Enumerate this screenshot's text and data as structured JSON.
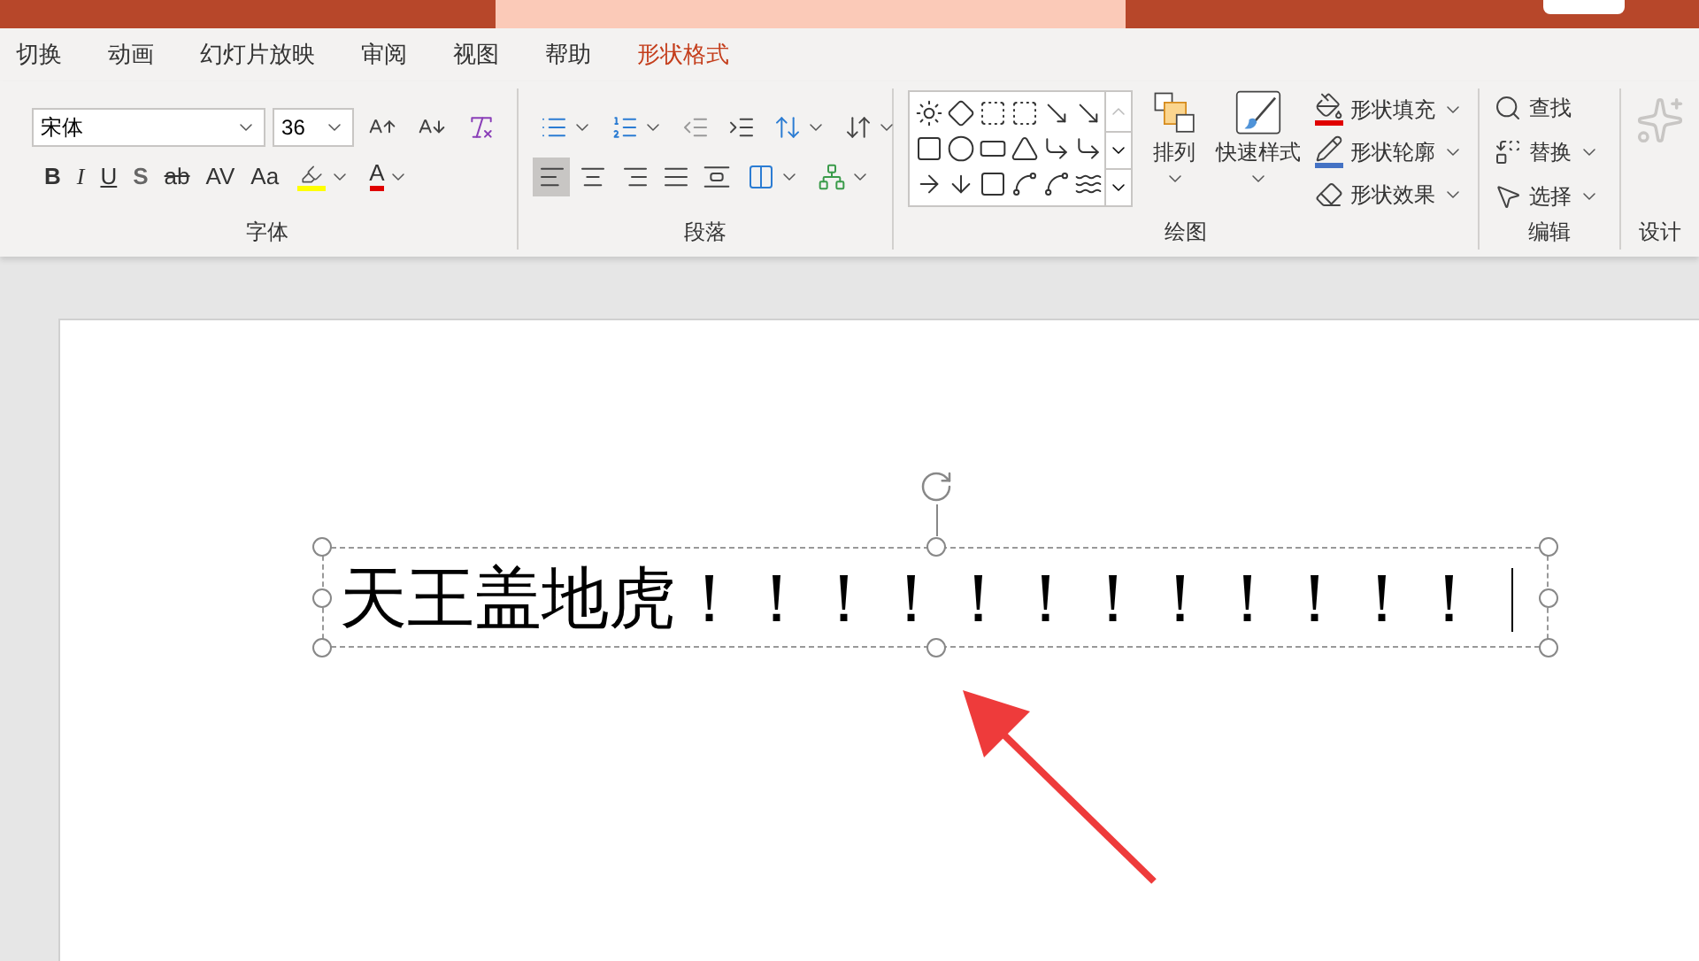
{
  "tabs": [
    {
      "label": "切换",
      "selected": false
    },
    {
      "label": "动画",
      "selected": false
    },
    {
      "label": "幻灯片放映",
      "selected": false
    },
    {
      "label": "审阅",
      "selected": false
    },
    {
      "label": "视图",
      "selected": false
    },
    {
      "label": "帮助",
      "selected": false
    },
    {
      "label": "形状格式",
      "selected": true
    }
  ],
  "font_group": {
    "label": "字体",
    "font_name": "宋体",
    "font_size": "36",
    "format_buttons": [
      {
        "kind": "bold",
        "label": "B"
      },
      {
        "kind": "italic",
        "label": "I"
      },
      {
        "kind": "underline",
        "label": "U"
      },
      {
        "kind": "shadow",
        "label": "S"
      },
      {
        "kind": "strike",
        "label": "ab"
      },
      {
        "kind": "spacing",
        "label": "AV"
      },
      {
        "kind": "case",
        "label": "Aa"
      }
    ],
    "font_color_label": "A"
  },
  "paragraph_group": {
    "label": "段落",
    "alignments": [
      {
        "kind": "left",
        "selected": true
      },
      {
        "kind": "center",
        "selected": false
      },
      {
        "kind": "right",
        "selected": false
      },
      {
        "kind": "justify",
        "selected": false
      },
      {
        "kind": "distributed",
        "selected": false
      }
    ]
  },
  "drawing_group": {
    "label": "绘图",
    "arrange": "排列",
    "quick_styles": "快速样式",
    "shape_commands": [
      {
        "kind": "fill",
        "label": "形状填充"
      },
      {
        "kind": "outline",
        "label": "形状轮廓"
      },
      {
        "kind": "effects",
        "label": "形状效果"
      }
    ]
  },
  "editing_group": {
    "label": "编辑",
    "commands": [
      {
        "kind": "find",
        "label": "查找",
        "has_menu": false
      },
      {
        "kind": "replace",
        "label": "替换",
        "has_menu": true
      },
      {
        "kind": "select",
        "label": "选择",
        "has_menu": true
      }
    ]
  },
  "design_group": {
    "label": "设计"
  },
  "slide": {
    "text": "天王盖地虎！！！！！！！！！！！！"
  }
}
